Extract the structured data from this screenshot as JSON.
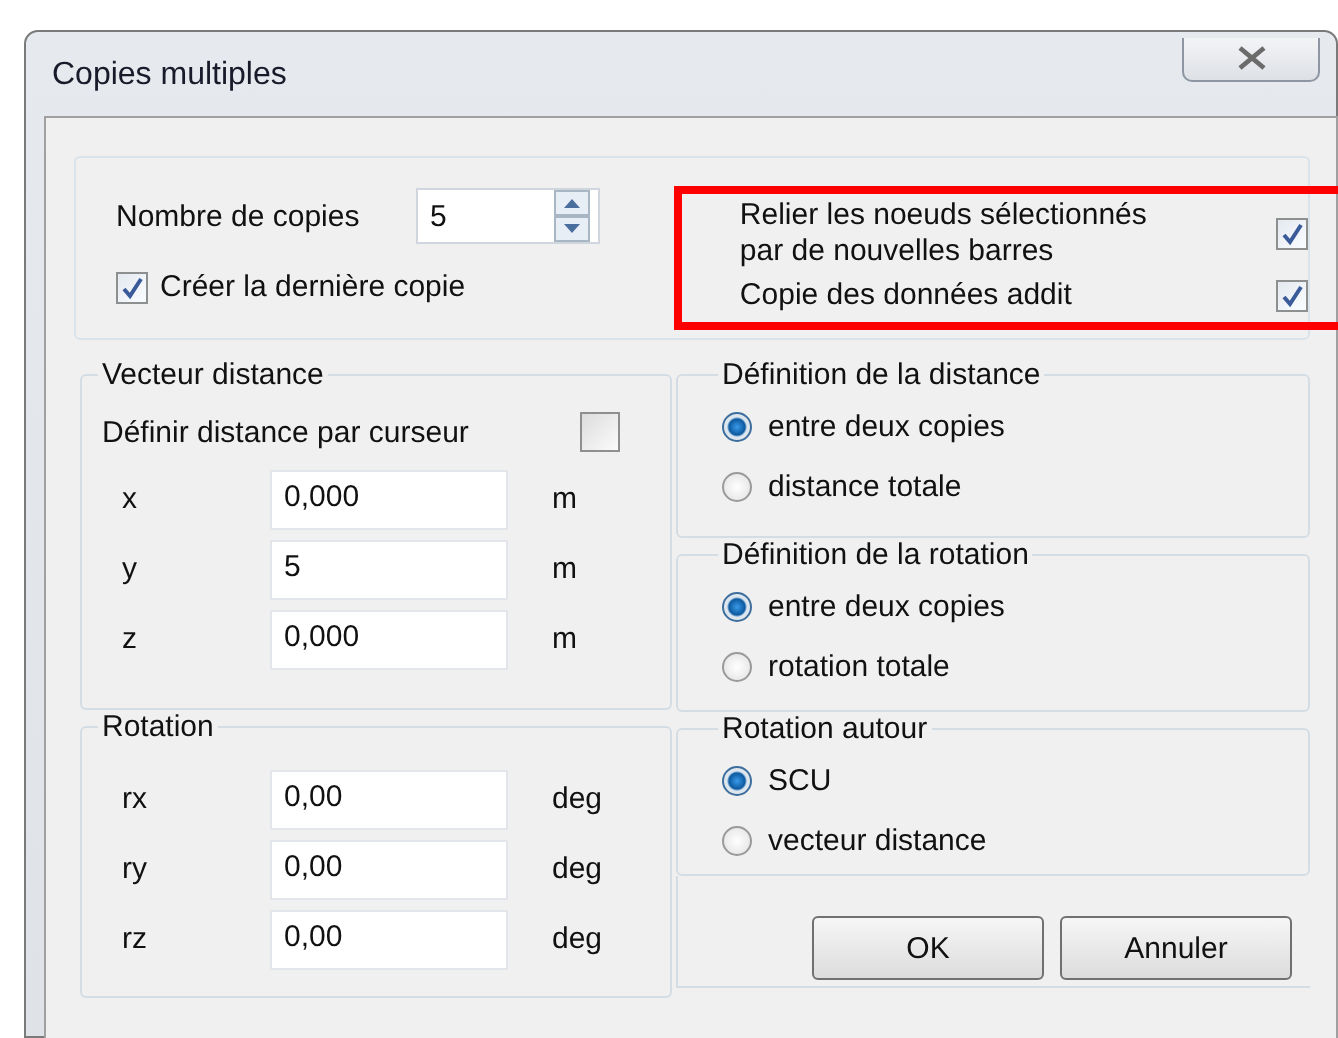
{
  "window": {
    "title": "Copies multiples"
  },
  "copies": {
    "label": "Nombre de copies",
    "value": "5"
  },
  "create_last": {
    "label": "Créer la dernière copie",
    "checked": true
  },
  "options": [
    {
      "label": "Relier les noeuds sélectionnés par de nouvelles barres",
      "checked": true
    },
    {
      "label": "Copie des données addit",
      "checked": true
    }
  ],
  "annotation": {
    "color": "#ff0000"
  },
  "distance_vector": {
    "title": "Vecteur distance",
    "cursor": {
      "label": "Définir distance par curseur",
      "checked": false
    },
    "fields": [
      {
        "label": "x",
        "value": "0,000",
        "unit": "m"
      },
      {
        "label": "y",
        "value": "5",
        "unit": "m"
      },
      {
        "label": "z",
        "value": "0,000",
        "unit": "m"
      }
    ]
  },
  "rotation": {
    "title": "Rotation",
    "fields": [
      {
        "label": "rx",
        "value": "0,00",
        "unit": "deg"
      },
      {
        "label": "ry",
        "value": "0,00",
        "unit": "deg"
      },
      {
        "label": "rz",
        "value": "0,00",
        "unit": "deg"
      }
    ]
  },
  "radio_groups": [
    {
      "title": "Définition de la distance",
      "options": [
        {
          "label": "entre deux copies",
          "selected": true
        },
        {
          "label": "distance totale",
          "selected": false
        }
      ]
    },
    {
      "title": "Définition de la rotation",
      "options": [
        {
          "label": "entre deux copies",
          "selected": true
        },
        {
          "label": "rotation totale",
          "selected": false
        }
      ]
    },
    {
      "title": "Rotation autour",
      "options": [
        {
          "label": "SCU",
          "selected": true
        },
        {
          "label": "vecteur distance",
          "selected": false
        }
      ]
    }
  ],
  "buttons": [
    "OK",
    "Annuler"
  ]
}
